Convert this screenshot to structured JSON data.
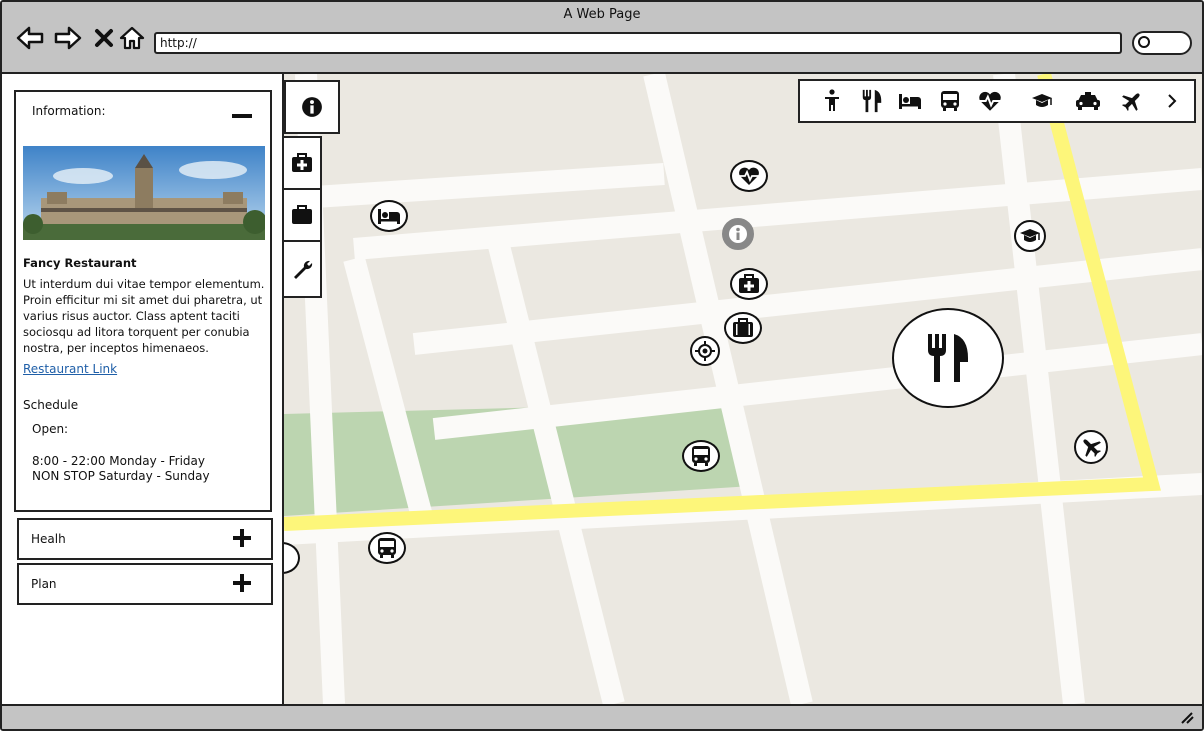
{
  "window": {
    "title": "A Web Page",
    "address": "http://"
  },
  "side_tabs": [
    {
      "icon": "info-icon"
    },
    {
      "icon": "first-aid-icon"
    },
    {
      "icon": "briefcase-icon"
    },
    {
      "icon": "wrench-icon"
    }
  ],
  "info_panel": {
    "header": "Information:",
    "name": "Fancy Restaurant",
    "description": "Ut interdum dui vitae tempor elementum. Proin efficitur mi sit amet dui pharetra, ut varius risus auctor. Class aptent taciti sociosqu ad litora torquent per conubia nostra, per inceptos himenaeos.",
    "link_label": "Restaurant Link",
    "schedule_label": "Schedule",
    "open_label": "Open:",
    "hours_line1": "8:00 - 22:00 Monday - Friday",
    "hours_line2": "NON STOP Saturday - Sunday"
  },
  "accordion": {
    "health_label": "Healh",
    "plan_label": "Plan"
  },
  "category_toolbar": [
    "person-icon",
    "restaurant-icon",
    "bed-icon",
    "bus-icon",
    "heartbeat-icon",
    "graduation-cap-icon",
    "taxi-icon",
    "plane-icon",
    "chevron-right-icon"
  ],
  "map_markers": [
    "heartbeat-icon",
    "bed-icon",
    "info-icon",
    "graduation-cap-icon",
    "first-aid-icon",
    "briefcase-icon",
    "crosshair-icon",
    "bus-icon",
    "plane-icon",
    "bus-icon",
    "restaurant-icon"
  ],
  "colors": {
    "chrome": "#c4c4c4",
    "map_bg": "#ebe8e1",
    "park": "#bcd5b0",
    "highway": "#fdf67a",
    "link": "#1f5fa8"
  }
}
